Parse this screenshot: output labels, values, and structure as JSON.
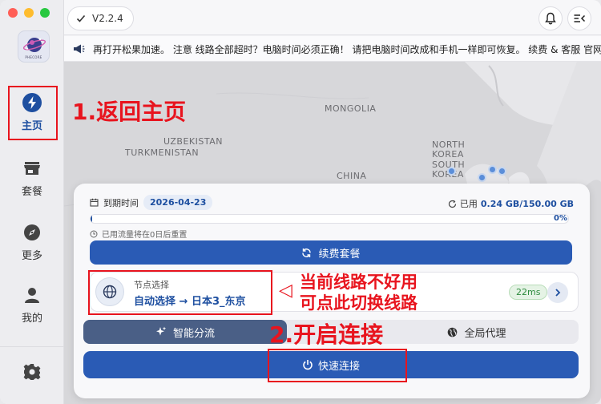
{
  "sidebar": {
    "logo_text": "PHECORE",
    "nav": [
      {
        "label": "主页",
        "icon": "bolt-icon"
      },
      {
        "label": "套餐",
        "icon": "store-icon"
      },
      {
        "label": "更多",
        "icon": "compass-icon"
      },
      {
        "label": "我的",
        "icon": "user-icon"
      }
    ],
    "settings_icon": "gear-icon"
  },
  "header": {
    "version": "V2.2.4",
    "bell_icon": "bell-icon",
    "menu_icon": "menu-collapse-icon"
  },
  "notice": {
    "text": "再打开松果加速。 注意 线路全部超时？电脑时间必须正确！ 请把电脑时间改成和手机一样即可恢复。 续费 & 客服 官网/"
  },
  "map": {
    "labels": [
      "MONGOLIA",
      "UZBEKISTAN",
      "TURKMENISTAN",
      "CHINA",
      "NORTH",
      "KOREA",
      "SOUTH",
      "KOREA"
    ]
  },
  "annotations": {
    "home": "1.返回主页",
    "switch_line_1": "当前线路不好用",
    "switch_line_2": "可点此切换线路",
    "connect": "2.开启连接",
    "arrow": "◁"
  },
  "card": {
    "expiry_label": "到期时间",
    "expiry_date": "2026-04-23",
    "usage_label": "已用",
    "usage_value": "0.24 GB/150.00 GB",
    "usage_percent": "0%",
    "usage_fraction": 0.0016,
    "reset_text": "已用流量将在0日后重置",
    "renew_label": "续费套餐",
    "node_title": "节点选择",
    "node_selection": "自动选择 → 日本3_东京",
    "latency": "22ms",
    "mode_smart": "智能分流",
    "mode_global": "全局代理",
    "connect_label": "快速连接"
  },
  "colors": {
    "accent": "#2a5bb5",
    "annotation": "#e8141e",
    "latency_green": "#2e8b3e"
  }
}
